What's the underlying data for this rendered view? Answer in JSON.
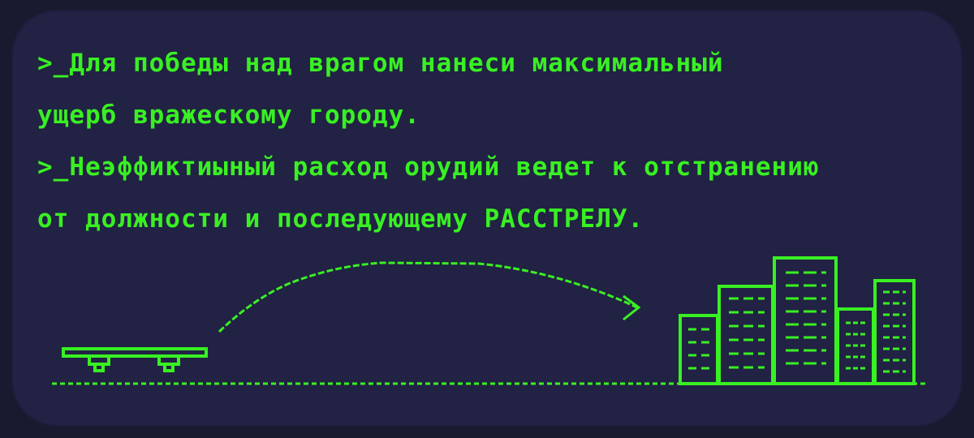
{
  "briefing": {
    "lines": [
      ">_Для победы над врагом нанеси максимальный",
      "ущерб вражескому городу.",
      ">_Неэффиктиыный расход орудий ведет к отстранению",
      "от должности и последующему РАССТРЕЛУ."
    ]
  },
  "colors": {
    "background": "#181a30",
    "panel": "#212244",
    "accent": "#39f022"
  }
}
